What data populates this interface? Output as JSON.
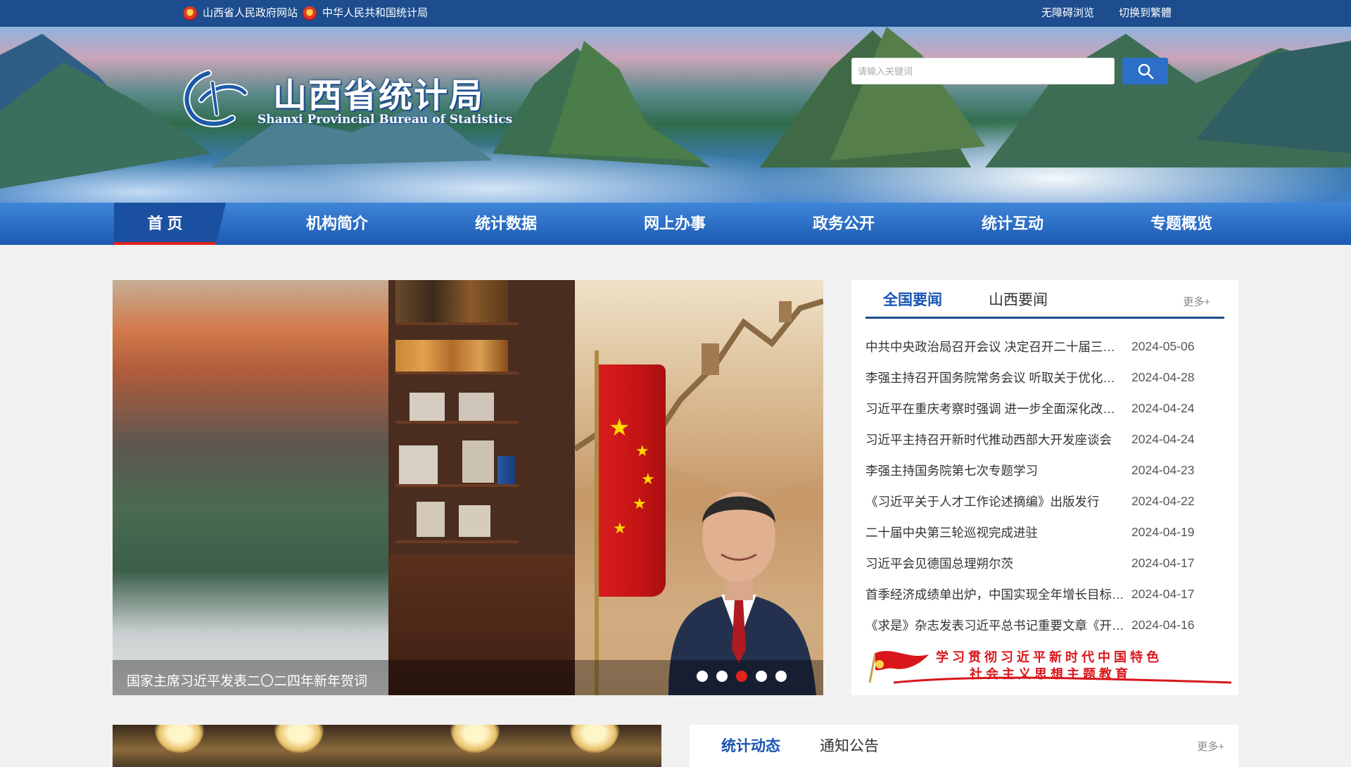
{
  "topbar": {
    "links": [
      "山西省人民政府网站",
      "中华人民共和国统计局"
    ],
    "accessibility": "无障碍浏览",
    "traditional": "切换到繁體"
  },
  "header": {
    "title_cn": "山西省统计局",
    "title_en": "Shanxi Provincial Bureau of Statistics",
    "search_placeholder": "请输入关键词"
  },
  "nav": {
    "items": [
      "首  页",
      "机构简介",
      "统计数据",
      "网上办事",
      "政务公开",
      "统计互动",
      "专题概览"
    ]
  },
  "slider": {
    "caption": "国家主席习近平发表二〇二四年新年贺词",
    "dot_count": 5,
    "active_dot": 3
  },
  "news": {
    "tabs": [
      "全国要闻",
      "山西要闻"
    ],
    "more": "更多+",
    "items": [
      {
        "title": "中共中央政治局召开会议 决定召开二十届三中全会",
        "date": "2024-05-06"
      },
      {
        "title": "李强主持召开国务院常务会议 听取关于优化营商环境",
        "date": "2024-04-28"
      },
      {
        "title": "习近平在重庆考察时强调 进一步全面深化改革开放",
        "date": "2024-04-24"
      },
      {
        "title": "习近平主持召开新时代推动西部大开发座谈会",
        "date": "2024-04-24"
      },
      {
        "title": "李强主持国务院第七次专题学习",
        "date": "2024-04-23"
      },
      {
        "title": "《习近平关于人才工作论述摘编》出版发行",
        "date": "2024-04-22"
      },
      {
        "title": "二十届中央第三轮巡视完成进驻",
        "date": "2024-04-19"
      },
      {
        "title": "习近平会见德国总理朔尔茨",
        "date": "2024-04-17"
      },
      {
        "title": "首季经济成绩单出炉，中国实现全年增长目标有底气",
        "date": "2024-04-17"
      },
      {
        "title": "《求是》杂志发表习近平总书记重要文章《开创我国",
        "date": "2024-04-16"
      }
    ],
    "theme_line1": "学习贯彻习近平新时代中国特色",
    "theme_line2": "社会主义思想主题教育"
  },
  "section2": {
    "tabs": [
      "统计动态",
      "通知公告"
    ],
    "more": "更多+"
  },
  "colors": {
    "primary": "#1d4d8e",
    "accent_red": "#e2231a",
    "link_blue": "#1a55b3"
  }
}
